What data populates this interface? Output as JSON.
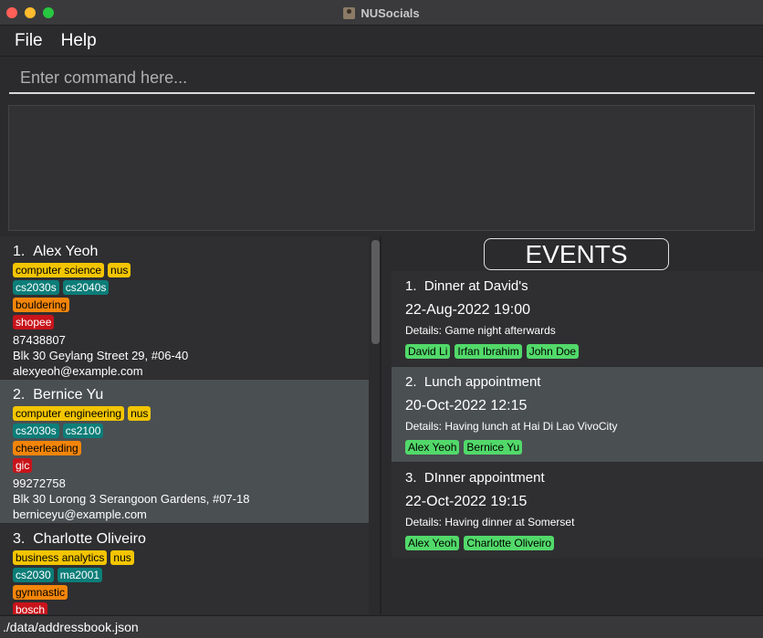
{
  "window": {
    "title": "NUSocials"
  },
  "menu": {
    "file": "File",
    "help": "Help"
  },
  "command": {
    "placeholder": "Enter command here...",
    "value": ""
  },
  "result": {
    "text": ""
  },
  "persons": [
    {
      "index": "1.",
      "name": "Alex Yeoh",
      "tag_rows": [
        [
          {
            "label": "computer science",
            "color": "#f3c500"
          },
          {
            "label": "nus",
            "color": "#f3c500"
          }
        ],
        [
          {
            "label": "cs2030s",
            "color": "#0c7d78"
          },
          {
            "label": "cs2040s",
            "color": "#0c7d78"
          }
        ],
        [
          {
            "label": "bouldering",
            "color": "#f3850a"
          }
        ],
        [
          {
            "label": "shopee",
            "color": "#c8141b"
          }
        ]
      ],
      "phone": "87438807",
      "address": "Blk 30 Geylang Street 29, #06-40",
      "email": "alexyeoh@example.com"
    },
    {
      "index": "2.",
      "name": "Bernice Yu",
      "tag_rows": [
        [
          {
            "label": "computer engineering",
            "color": "#f3c500"
          },
          {
            "label": "nus",
            "color": "#f3c500"
          }
        ],
        [
          {
            "label": "cs2030s",
            "color": "#0c7d78"
          },
          {
            "label": "cs2100",
            "color": "#0c7d78"
          }
        ],
        [
          {
            "label": "cheerleading",
            "color": "#f3850a"
          }
        ],
        [
          {
            "label": "gic",
            "color": "#c8141b"
          }
        ]
      ],
      "phone": "99272758",
      "address": "Blk 30 Lorong 3 Serangoon Gardens, #07-18",
      "email": "berniceyu@example.com"
    },
    {
      "index": "3.",
      "name": "Charlotte Oliveiro",
      "tag_rows": [
        [
          {
            "label": "business analytics",
            "color": "#f3c500"
          },
          {
            "label": "nus",
            "color": "#f3c500"
          }
        ],
        [
          {
            "label": "cs2030",
            "color": "#0c7d78"
          },
          {
            "label": "ma2001",
            "color": "#0c7d78"
          }
        ],
        [
          {
            "label": "gymnastic",
            "color": "#f3850a"
          }
        ],
        [
          {
            "label": "bosch",
            "color": "#c8141b"
          }
        ]
      ]
    }
  ],
  "events": {
    "header": "EVENTS",
    "items": [
      {
        "index": "1.",
        "title": "Dinner at David's",
        "datetime": "22-Aug-2022 19:00",
        "details": "Details: Game night afterwards",
        "participants": [
          "David Li",
          "Irfan Ibrahim",
          "John Doe"
        ]
      },
      {
        "index": "2.",
        "title": "Lunch appointment",
        "datetime": "20-Oct-2022 12:15",
        "details": "Details: Having lunch at Hai Di Lao VivoCity",
        "participants": [
          "Alex Yeoh",
          "Bernice Yu"
        ]
      },
      {
        "index": "3.",
        "title": "DInner appointment",
        "datetime": "22-Oct-2022 19:15",
        "details": "Details: Having dinner at Somerset",
        "participants": [
          "Alex Yeoh",
          "Charlotte Oliveiro"
        ]
      }
    ]
  },
  "status": {
    "path": "./data/addressbook.json"
  }
}
